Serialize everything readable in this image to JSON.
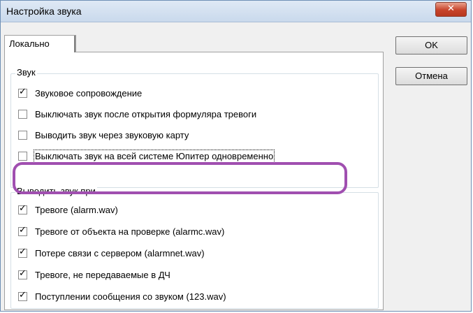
{
  "window": {
    "title": "Настройка звука",
    "close_icon": "close-icon",
    "close_glyph": "✕"
  },
  "tabs": [
    {
      "label": "Локально",
      "active": true
    }
  ],
  "sound_group": {
    "legend": "Звук",
    "options": [
      {
        "label": "Звуковое сопровождение",
        "checked": true
      },
      {
        "label": "Выключать звук после открытия формуляра тревоги",
        "checked": false
      },
      {
        "label": "Выводить звук через звуковую карту",
        "checked": false
      },
      {
        "label": "Выключать звук на всей системе Юпитер одновременно",
        "checked": false,
        "focused": true,
        "highlighted": true
      }
    ]
  },
  "play_group": {
    "legend": "Выводить звук при",
    "options": [
      {
        "label": "Тревоге (alarm.wav)",
        "checked": true
      },
      {
        "label": "Тревоге от объекта на проверке (alarmc.wav)",
        "checked": true
      },
      {
        "label": "Потере связи с сервером (alarmnet.wav)",
        "checked": true
      },
      {
        "label": "Тревоге, не передаваемые в ДЧ",
        "checked": true
      },
      {
        "label": "Поступлении сообщения со звуком (123.wav)",
        "checked": true
      }
    ]
  },
  "buttons": {
    "ok": "OK",
    "cancel": "Отмена"
  },
  "check_glyph": "✓",
  "colors": {
    "highlight": "#a04fb0",
    "close_button": "#c7432a"
  }
}
